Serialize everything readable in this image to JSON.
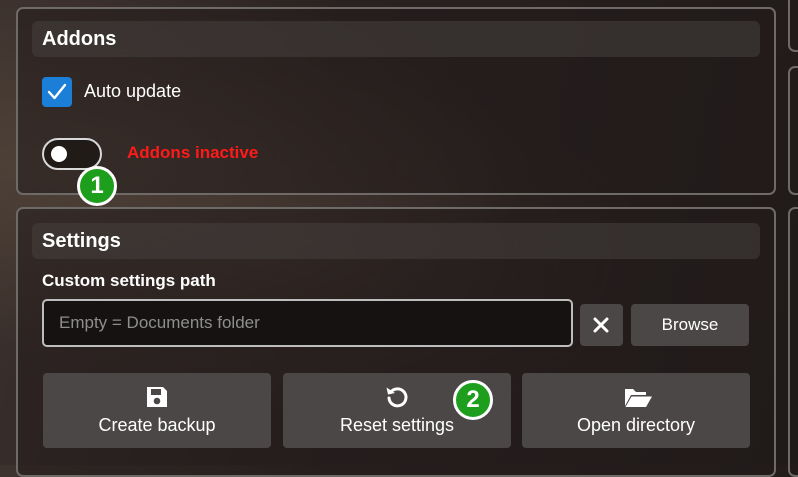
{
  "addons": {
    "title": "Addons",
    "auto_update_label": "Auto update",
    "auto_update_checked": true,
    "addons_toggle_on": false,
    "status_text": "Addons inactive",
    "status_color": "#ff1a1a"
  },
  "settings": {
    "title": "Settings",
    "custom_path_label": "Custom settings path",
    "path_input": {
      "value": "",
      "placeholder": "Empty = Documents folder"
    },
    "clear_icon": "close-icon",
    "browse_label": "Browse",
    "actions": [
      {
        "label": "Create backup",
        "icon": "save-icon"
      },
      {
        "label": "Reset settings",
        "icon": "reset-icon"
      },
      {
        "label": "Open directory",
        "icon": "folder-open-icon"
      }
    ]
  },
  "markers": [
    "1",
    "2"
  ],
  "colors": {
    "checkbox_accent": "#1b7fd8",
    "marker_green": "#1d9e1d"
  }
}
